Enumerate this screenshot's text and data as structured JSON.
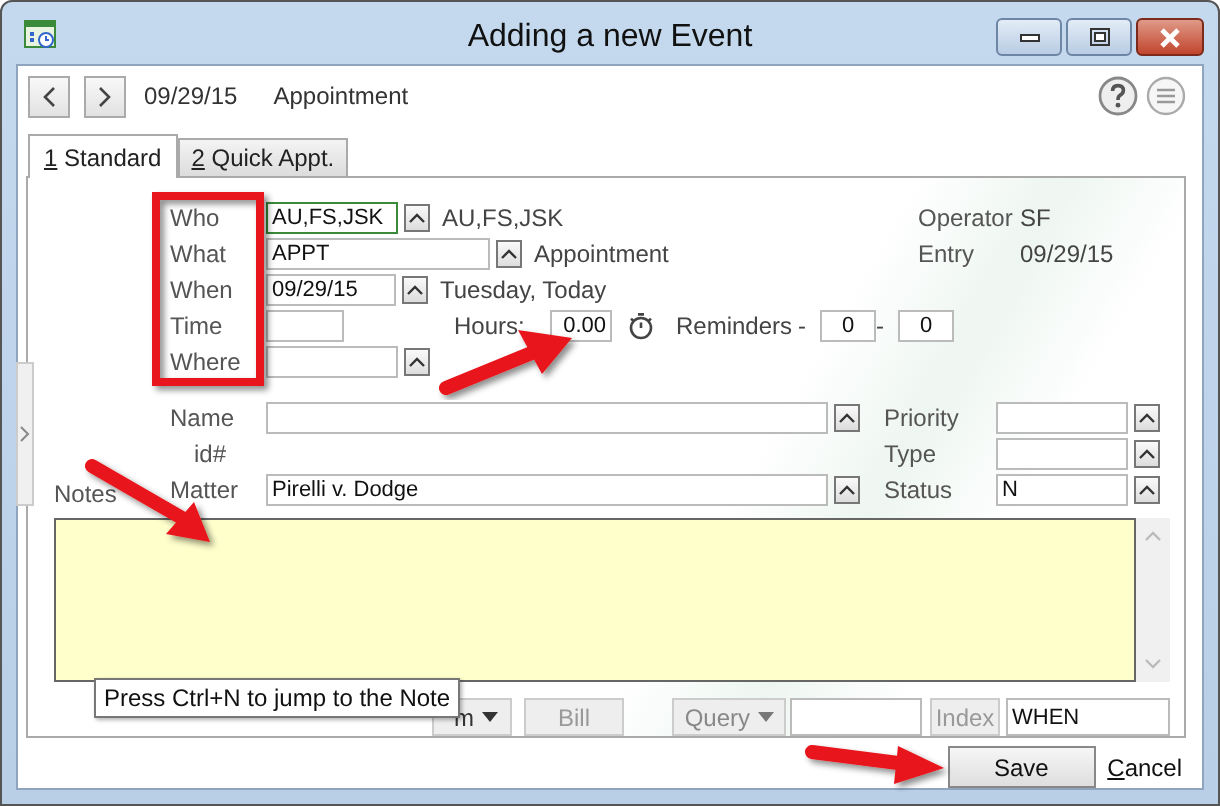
{
  "window": {
    "title": "Adding a new Event"
  },
  "nav": {
    "date": "09/29/15",
    "type": "Appointment"
  },
  "tabs": [
    {
      "label": "1 Standard",
      "selected": true
    },
    {
      "label": "2 Quick Appt.",
      "selected": false
    }
  ],
  "form": {
    "who": {
      "label": "Who",
      "value": "AU,FS,JSK",
      "display": "AU,FS,JSK",
      "focused": true
    },
    "what": {
      "label": "What",
      "value": "APPT",
      "display": "Appointment"
    },
    "when": {
      "label": "When",
      "value": "09/29/15",
      "display": "Tuesday, Today"
    },
    "time": {
      "label": "Time"
    },
    "hours": {
      "label": "Hours:",
      "value": "0.00"
    },
    "reminders": {
      "label": "Reminders",
      "items": [
        {
          "prefix": "-",
          "value": "0"
        },
        {
          "prefix": "-",
          "value": "0"
        }
      ]
    },
    "where": {
      "label": "Where"
    },
    "operator": {
      "label": "Operator",
      "value": "SF"
    },
    "entry": {
      "label": "Entry",
      "value": "09/29/15"
    },
    "name": {
      "label": "Name"
    },
    "id": {
      "label": "id#"
    },
    "matter": {
      "label": "Matter",
      "value": "Pirelli v. Dodge"
    },
    "priority": {
      "label": "Priority"
    },
    "type": {
      "label": "Type"
    },
    "status": {
      "label": "Status",
      "value": "N"
    },
    "notes": {
      "label": "Notes"
    }
  },
  "bottom": {
    "menu_button": "m",
    "bill": {
      "label": "Bill",
      "disabled": true
    },
    "query": {
      "label": "Query"
    },
    "index": {
      "label": "Index",
      "disabled": true
    },
    "index_value": "WHEN"
  },
  "tooltip": "Press Ctrl+N to jump to the Note",
  "buttons": {
    "save": "Save",
    "cancel": "Cancel"
  }
}
